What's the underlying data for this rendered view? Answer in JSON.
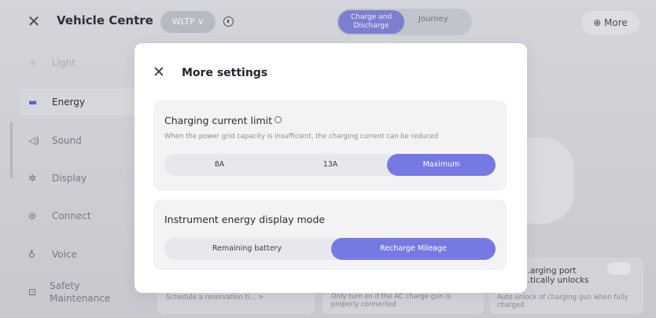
{
  "header": {
    "close_icon": "close-icon",
    "title": "Vehicle Centre",
    "wltp_label": "WLTP ∨",
    "info_icon": "info-icon",
    "tabs": [
      {
        "label": "Charge and Discharge",
        "active": true
      },
      {
        "label": "Journey",
        "active": false
      }
    ],
    "more_label": "⊕ More"
  },
  "sidebar": {
    "items": [
      {
        "icon": "light-icon",
        "label": "Light",
        "active": false
      },
      {
        "icon": "energy-icon",
        "label": "Energy",
        "active": true
      },
      {
        "icon": "sound-icon",
        "label": "Sound",
        "active": false
      },
      {
        "icon": "display-icon",
        "label": "Display",
        "active": false
      },
      {
        "icon": "connect-icon",
        "label": "Connect",
        "active": false
      },
      {
        "icon": "voice-icon",
        "label": "Voice",
        "active": false
      },
      {
        "icon": "safety-icon",
        "label": "Safety Maintenance",
        "active": false
      }
    ]
  },
  "background_cards": [
    {
      "text": "Schedule a reservation ti... >"
    },
    {
      "text": "Only turn on if the AC charge gun is properly connected"
    },
    {
      "title": "...arging port ...tically unlocks",
      "text": "Auto unlock of charging gun when fully charged"
    }
  ],
  "modal": {
    "close_icon": "close-icon",
    "title": "More settings",
    "charging_limit": {
      "title": "Charging current limit",
      "help_icon": "help-icon",
      "description": "When the power grid capacity is insufficient, the charging current can be reduced",
      "options": [
        {
          "label": "8A",
          "selected": false
        },
        {
          "label": "13A",
          "selected": false
        },
        {
          "label": "Maximum",
          "selected": true
        }
      ]
    },
    "display_mode": {
      "title": "Instrument energy display mode",
      "options": [
        {
          "label": "Remaining battery",
          "selected": false
        },
        {
          "label": "Recharge Mileage",
          "selected": true
        }
      ]
    }
  },
  "colors": {
    "accent": "#7679e4",
    "backdrop": "#c9cbd1",
    "modal_bg": "#ffffff",
    "group_bg": "#f3f3f5"
  }
}
